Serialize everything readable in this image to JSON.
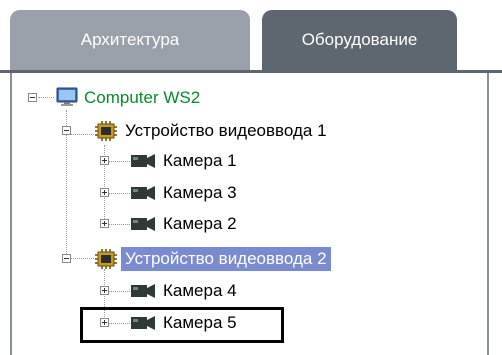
{
  "tabs": [
    {
      "label": "Архитектура",
      "active": false
    },
    {
      "label": "Оборудование",
      "active": true
    }
  ],
  "tree": {
    "root": {
      "label": "Computer WS2",
      "icon": "computer-icon",
      "color": "#0a8a2a"
    },
    "devices": [
      {
        "label": "Устройство видеоввода 1",
        "icon": "capture-board-icon",
        "selected": false,
        "cameras": [
          {
            "label": "Камера 1",
            "icon": "camera-icon"
          },
          {
            "label": "Камера 3",
            "icon": "camera-icon"
          },
          {
            "label": "Камера 2",
            "icon": "camera-icon"
          }
        ]
      },
      {
        "label": "Устройство видеоввода 2",
        "icon": "capture-board-icon",
        "selected": true,
        "cameras": [
          {
            "label": "Камера 4",
            "icon": "camera-icon"
          },
          {
            "label": "Камера 5",
            "icon": "camera-icon"
          }
        ]
      }
    ]
  },
  "colors": {
    "selection": "#7b8bd1",
    "tab_active": "#5e6670",
    "tab_inactive": "#9aa0a9",
    "highlight_frame": "#000000"
  }
}
